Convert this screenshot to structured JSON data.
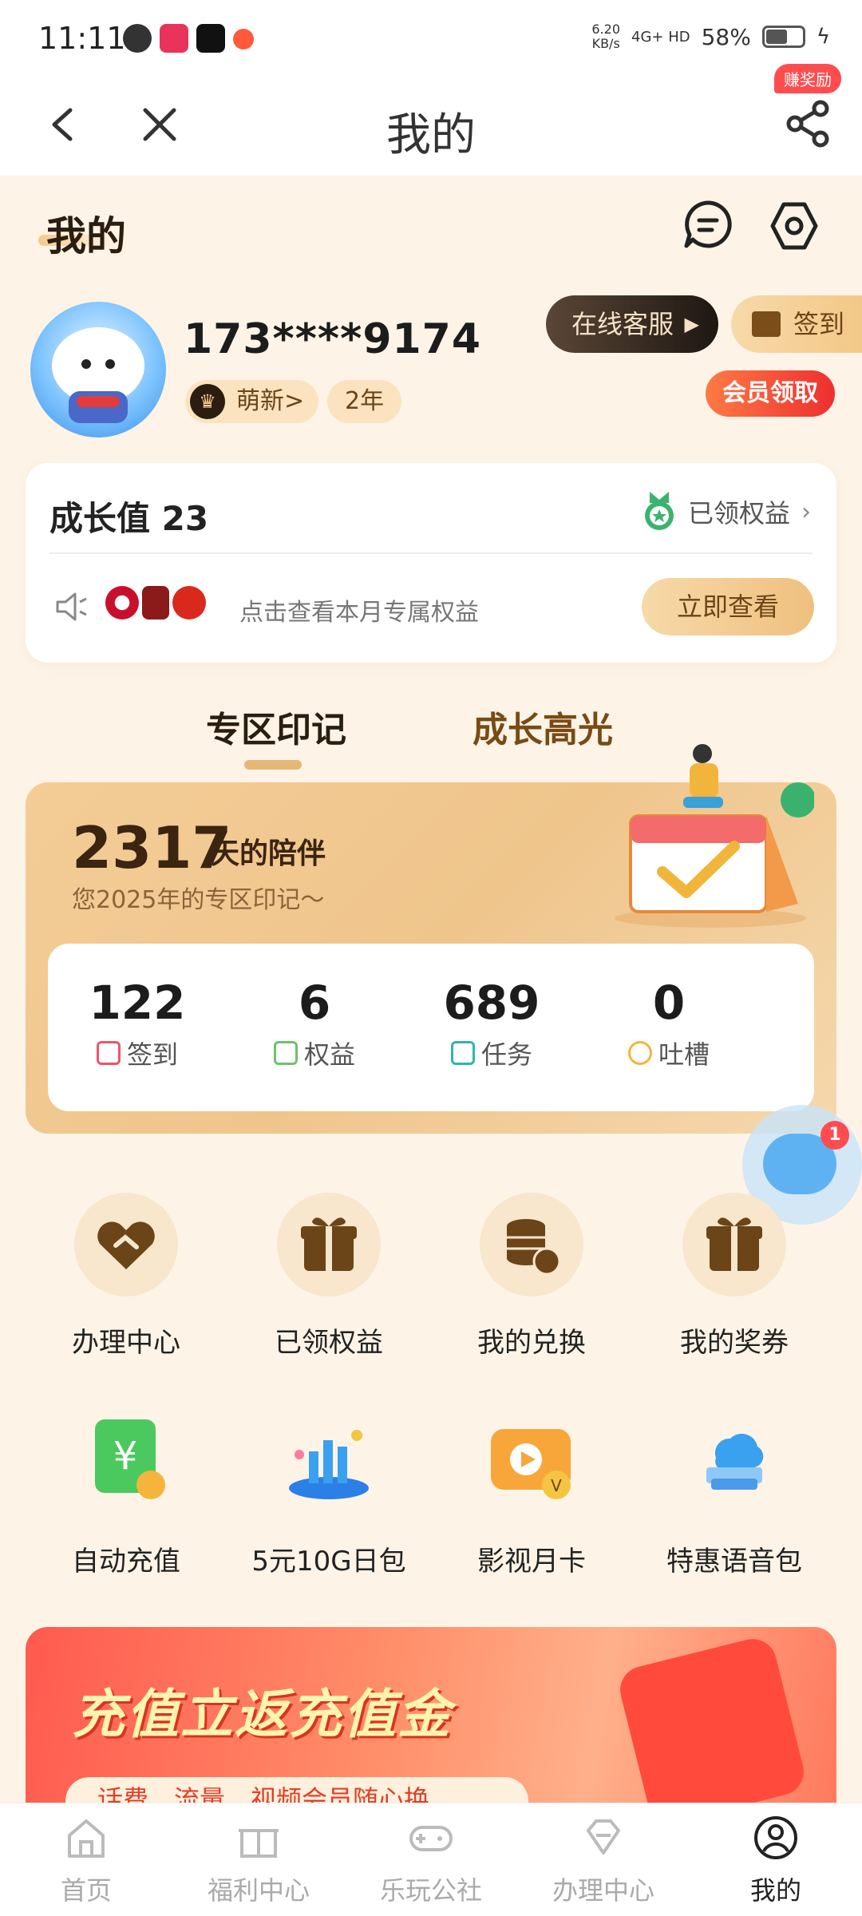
{
  "status_bar": {
    "time": "11:11",
    "net_speed": "6.20",
    "net_unit": "KB/s",
    "signal": "4G+ HD",
    "battery": "58%"
  },
  "nav": {
    "title": "我的",
    "reward_badge": "赚奖励"
  },
  "header": {
    "title": "我的"
  },
  "profile": {
    "phone": "173****9174",
    "level_tag": "萌新>",
    "years_tag": "2年",
    "service_button": "在线客服",
    "checkin_button": "签到",
    "member_button": "会员领取"
  },
  "growth": {
    "label": "成长值 23",
    "claimed_link": "已领权益",
    "promo_text": "点击查看本月专属权益",
    "view_button": "立即查看"
  },
  "tabs": [
    "专区印记",
    "成长高光"
  ],
  "summary": {
    "days": "2317",
    "days_unit": "天的陪伴",
    "subtitle": "您2025年的专区印记～",
    "stats": [
      {
        "num": "122",
        "label": "签到",
        "color": "#f0546b"
      },
      {
        "num": "6",
        "label": "权益",
        "color": "#6cc36a"
      },
      {
        "num": "689",
        "label": "任务",
        "color": "#2fb5b0"
      },
      {
        "num": "0",
        "label": "吐槽",
        "color": "#f2b53c"
      }
    ]
  },
  "float_chat": {
    "badge": "1"
  },
  "grid_row1": [
    "办理中心",
    "已领权益",
    "我的兑换",
    "我的奖券"
  ],
  "grid_row2": [
    "自动充值",
    "5元10G日包",
    "影视月卡",
    "特惠语音包"
  ],
  "banner": {
    "headline": "充值立返充值金",
    "sub": "话费、流量、视频会员随心换"
  },
  "tabbar": [
    "首页",
    "福利中心",
    "乐玩公社",
    "办理中心",
    "我的"
  ],
  "colors": {
    "accent": "#e6b777",
    "page_bg": "#fdf4e7",
    "dark_brown": "#2b1d10"
  }
}
